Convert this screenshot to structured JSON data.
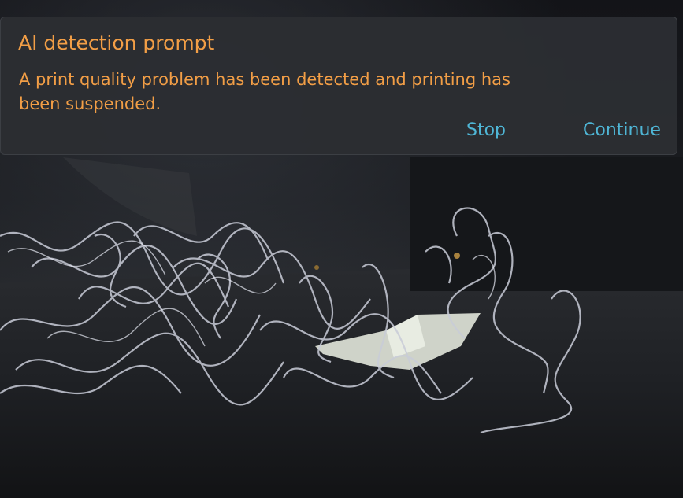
{
  "camera_feed": {
    "description_icon": "camera-feed"
  },
  "dialog": {
    "title": "AI detection prompt",
    "message": "A print quality problem has been detected and printing has been suspended.",
    "stop_label": "Stop",
    "continue_label": "Continue"
  },
  "colors": {
    "title": "#f29e46",
    "message": "#f29e46",
    "action": "#4fb6d6",
    "dialog_background": "#2c2e32"
  }
}
